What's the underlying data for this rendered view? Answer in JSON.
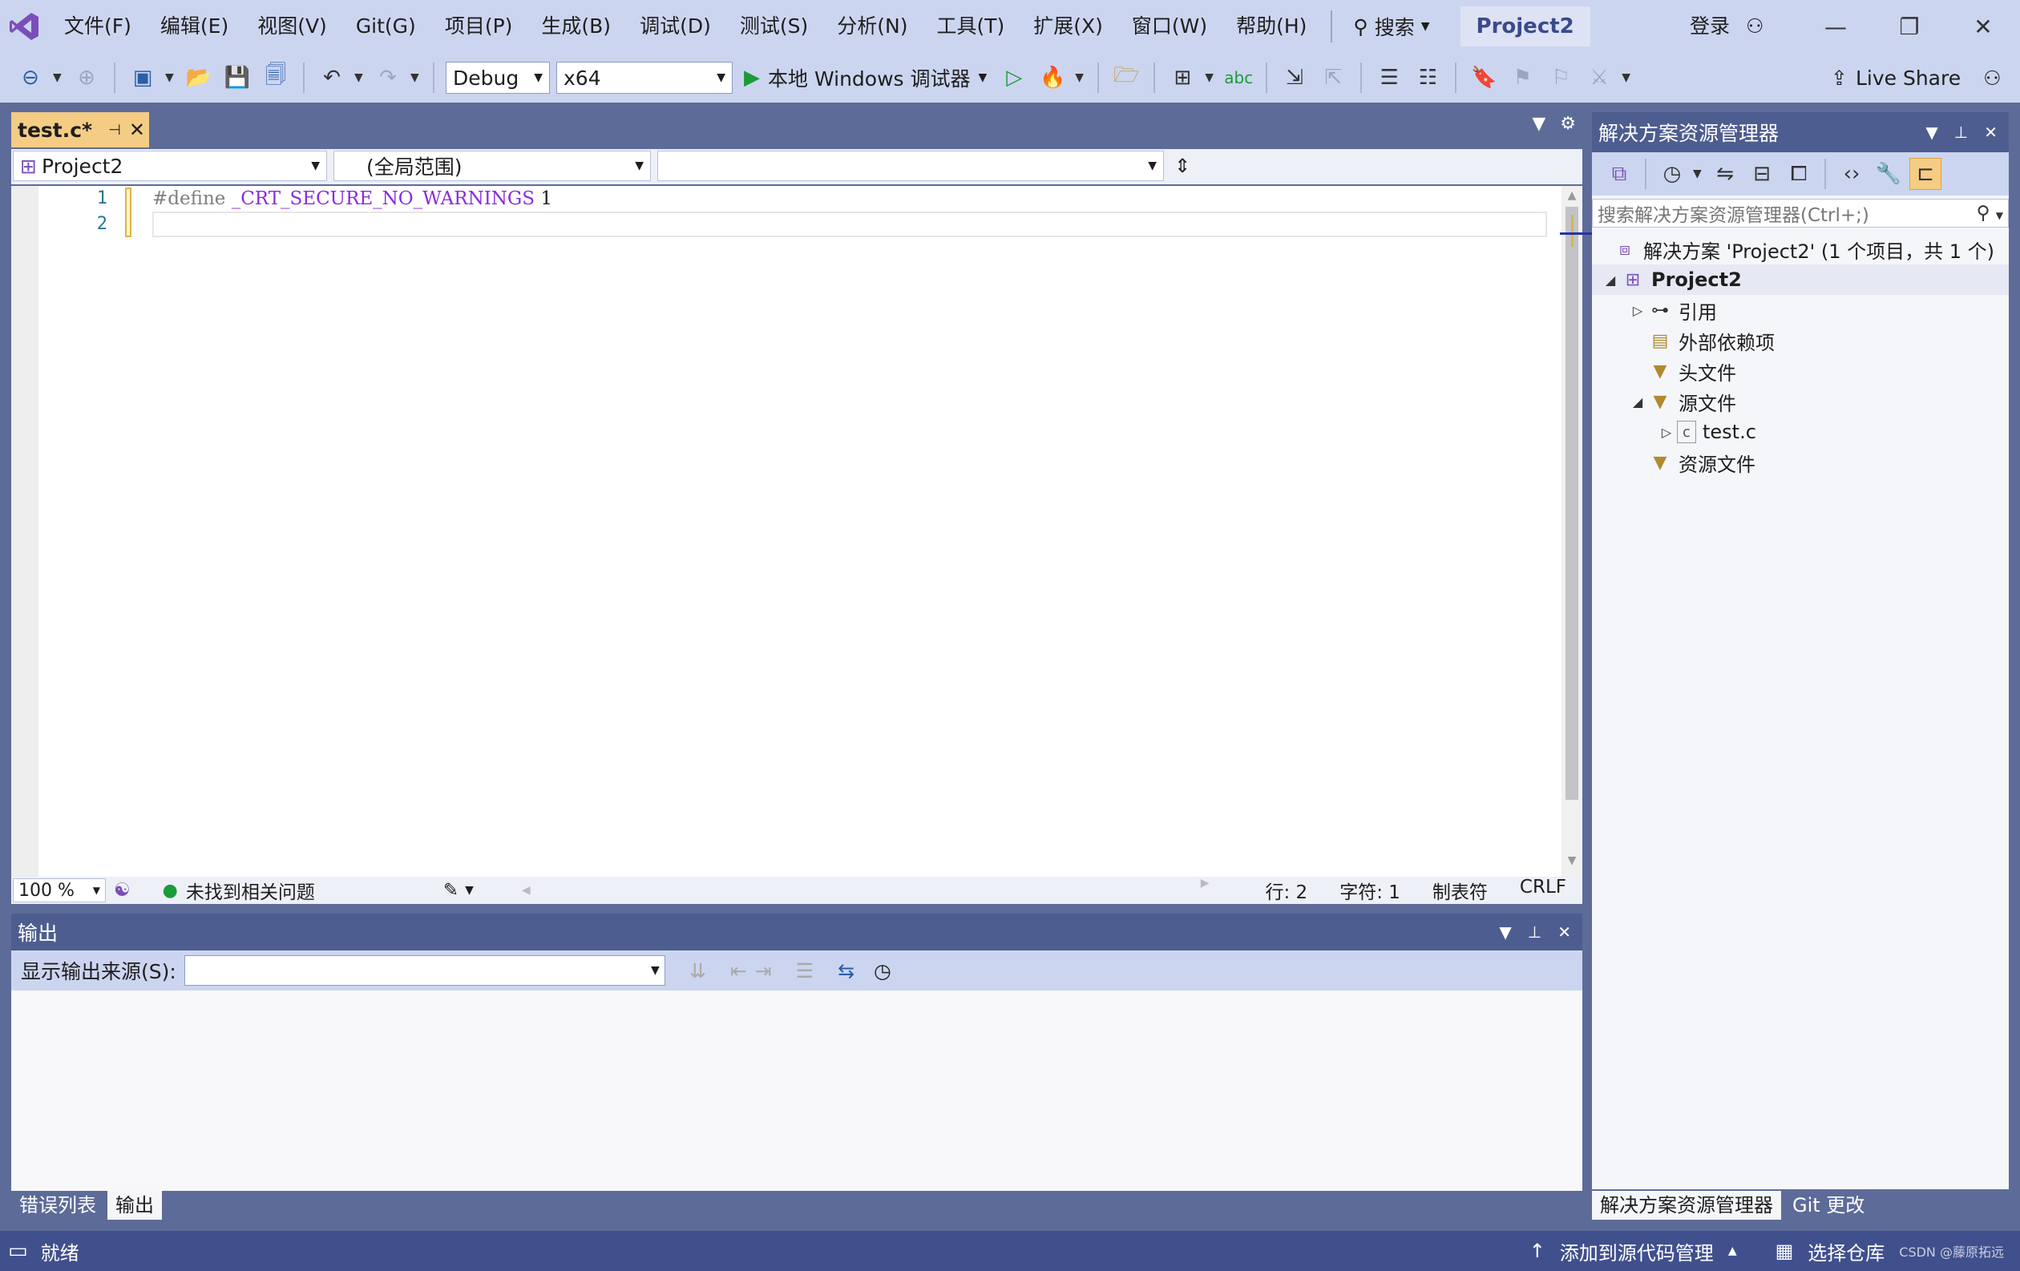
{
  "menu": {
    "items": [
      "文件(F)",
      "编辑(E)",
      "视图(V)",
      "Git(G)",
      "项目(P)",
      "生成(B)",
      "调试(D)",
      "测试(S)",
      "分析(N)",
      "工具(T)",
      "扩展(X)",
      "窗口(W)",
      "帮助(H)"
    ],
    "search_label": "搜索",
    "project_name": "Project2",
    "login_label": "登录"
  },
  "toolbar": {
    "config": "Debug",
    "platform": "x64",
    "run_label": "本地 Windows 调试器",
    "live_share": "Live Share"
  },
  "editor": {
    "tab_title": "test.c*",
    "nav_project": "Project2",
    "nav_scope": "(全局范围)",
    "nav_member": "",
    "line_numbers": [
      "1",
      "2"
    ],
    "code_line1_pp": "#define",
    "code_line1_macro": "_CRT_SECURE_NO_WARNINGS",
    "code_line1_value": "1",
    "zoom": "100 %",
    "issues": "未找到相关问题",
    "row": "行: 2",
    "col": "字符: 1",
    "tabs_mode": "制表符",
    "line_ending": "CRLF"
  },
  "output": {
    "title": "输出",
    "source_label": "显示输出来源(S):",
    "source_value": ""
  },
  "bottom_tabs": [
    "错误列表",
    "输出"
  ],
  "solution": {
    "title": "解决方案资源管理器",
    "search_placeholder": "搜索解决方案资源管理器(Ctrl+;)",
    "root": "解决方案 'Project2' (1 个项目，共 1 个)",
    "project": "Project2",
    "references": "引用",
    "external": "外部依赖项",
    "headers": "头文件",
    "sources": "源文件",
    "file": "test.c",
    "resources": "资源文件",
    "tabs": [
      "解决方案资源管理器",
      "Git 更改"
    ]
  },
  "status": {
    "ready": "就绪",
    "add_source": "添加到源代码管理",
    "select_repo": "选择仓库",
    "watermark": "CSDN @藤原拓远"
  },
  "colors": {
    "frame": "#5d6b99",
    "chrome": "#ccd5f0",
    "status": "#40508d",
    "tab_active": "#f5cc84"
  }
}
